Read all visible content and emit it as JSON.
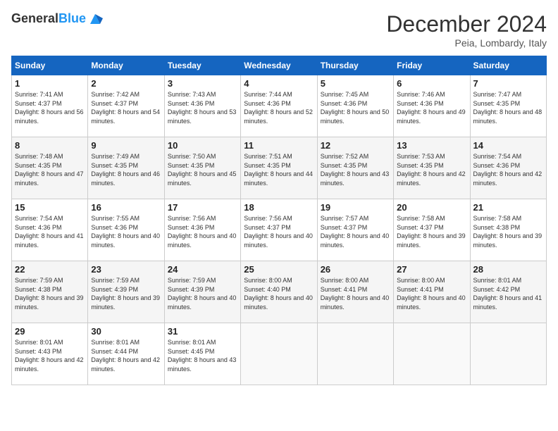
{
  "header": {
    "logo_general": "General",
    "logo_blue": "Blue",
    "month_title": "December 2024",
    "location": "Peia, Lombardy, Italy"
  },
  "weekdays": [
    "Sunday",
    "Monday",
    "Tuesday",
    "Wednesday",
    "Thursday",
    "Friday",
    "Saturday"
  ],
  "weeks": [
    [
      {
        "day": "1",
        "sunrise": "7:41 AM",
        "sunset": "4:37 PM",
        "daylight": "8 hours and 56 minutes."
      },
      {
        "day": "2",
        "sunrise": "7:42 AM",
        "sunset": "4:37 PM",
        "daylight": "8 hours and 54 minutes."
      },
      {
        "day": "3",
        "sunrise": "7:43 AM",
        "sunset": "4:36 PM",
        "daylight": "8 hours and 53 minutes."
      },
      {
        "day": "4",
        "sunrise": "7:44 AM",
        "sunset": "4:36 PM",
        "daylight": "8 hours and 52 minutes."
      },
      {
        "day": "5",
        "sunrise": "7:45 AM",
        "sunset": "4:36 PM",
        "daylight": "8 hours and 50 minutes."
      },
      {
        "day": "6",
        "sunrise": "7:46 AM",
        "sunset": "4:36 PM",
        "daylight": "8 hours and 49 minutes."
      },
      {
        "day": "7",
        "sunrise": "7:47 AM",
        "sunset": "4:35 PM",
        "daylight": "8 hours and 48 minutes."
      }
    ],
    [
      {
        "day": "8",
        "sunrise": "7:48 AM",
        "sunset": "4:35 PM",
        "daylight": "8 hours and 47 minutes."
      },
      {
        "day": "9",
        "sunrise": "7:49 AM",
        "sunset": "4:35 PM",
        "daylight": "8 hours and 46 minutes."
      },
      {
        "day": "10",
        "sunrise": "7:50 AM",
        "sunset": "4:35 PM",
        "daylight": "8 hours and 45 minutes."
      },
      {
        "day": "11",
        "sunrise": "7:51 AM",
        "sunset": "4:35 PM",
        "daylight": "8 hours and 44 minutes."
      },
      {
        "day": "12",
        "sunrise": "7:52 AM",
        "sunset": "4:35 PM",
        "daylight": "8 hours and 43 minutes."
      },
      {
        "day": "13",
        "sunrise": "7:53 AM",
        "sunset": "4:35 PM",
        "daylight": "8 hours and 42 minutes."
      },
      {
        "day": "14",
        "sunrise": "7:54 AM",
        "sunset": "4:36 PM",
        "daylight": "8 hours and 42 minutes."
      }
    ],
    [
      {
        "day": "15",
        "sunrise": "7:54 AM",
        "sunset": "4:36 PM",
        "daylight": "8 hours and 41 minutes."
      },
      {
        "day": "16",
        "sunrise": "7:55 AM",
        "sunset": "4:36 PM",
        "daylight": "8 hours and 40 minutes."
      },
      {
        "day": "17",
        "sunrise": "7:56 AM",
        "sunset": "4:36 PM",
        "daylight": "8 hours and 40 minutes."
      },
      {
        "day": "18",
        "sunrise": "7:56 AM",
        "sunset": "4:37 PM",
        "daylight": "8 hours and 40 minutes."
      },
      {
        "day": "19",
        "sunrise": "7:57 AM",
        "sunset": "4:37 PM",
        "daylight": "8 hours and 40 minutes."
      },
      {
        "day": "20",
        "sunrise": "7:58 AM",
        "sunset": "4:37 PM",
        "daylight": "8 hours and 39 minutes."
      },
      {
        "day": "21",
        "sunrise": "7:58 AM",
        "sunset": "4:38 PM",
        "daylight": "8 hours and 39 minutes."
      }
    ],
    [
      {
        "day": "22",
        "sunrise": "7:59 AM",
        "sunset": "4:38 PM",
        "daylight": "8 hours and 39 minutes."
      },
      {
        "day": "23",
        "sunrise": "7:59 AM",
        "sunset": "4:39 PM",
        "daylight": "8 hours and 39 minutes."
      },
      {
        "day": "24",
        "sunrise": "7:59 AM",
        "sunset": "4:39 PM",
        "daylight": "8 hours and 40 minutes."
      },
      {
        "day": "25",
        "sunrise": "8:00 AM",
        "sunset": "4:40 PM",
        "daylight": "8 hours and 40 minutes."
      },
      {
        "day": "26",
        "sunrise": "8:00 AM",
        "sunset": "4:41 PM",
        "daylight": "8 hours and 40 minutes."
      },
      {
        "day": "27",
        "sunrise": "8:00 AM",
        "sunset": "4:41 PM",
        "daylight": "8 hours and 40 minutes."
      },
      {
        "day": "28",
        "sunrise": "8:01 AM",
        "sunset": "4:42 PM",
        "daylight": "8 hours and 41 minutes."
      }
    ],
    [
      {
        "day": "29",
        "sunrise": "8:01 AM",
        "sunset": "4:43 PM",
        "daylight": "8 hours and 42 minutes."
      },
      {
        "day": "30",
        "sunrise": "8:01 AM",
        "sunset": "4:44 PM",
        "daylight": "8 hours and 42 minutes."
      },
      {
        "day": "31",
        "sunrise": "8:01 AM",
        "sunset": "4:45 PM",
        "daylight": "8 hours and 43 minutes."
      },
      null,
      null,
      null,
      null
    ]
  ],
  "labels": {
    "sunrise": "Sunrise: ",
    "sunset": "Sunset: ",
    "daylight": "Daylight: "
  }
}
